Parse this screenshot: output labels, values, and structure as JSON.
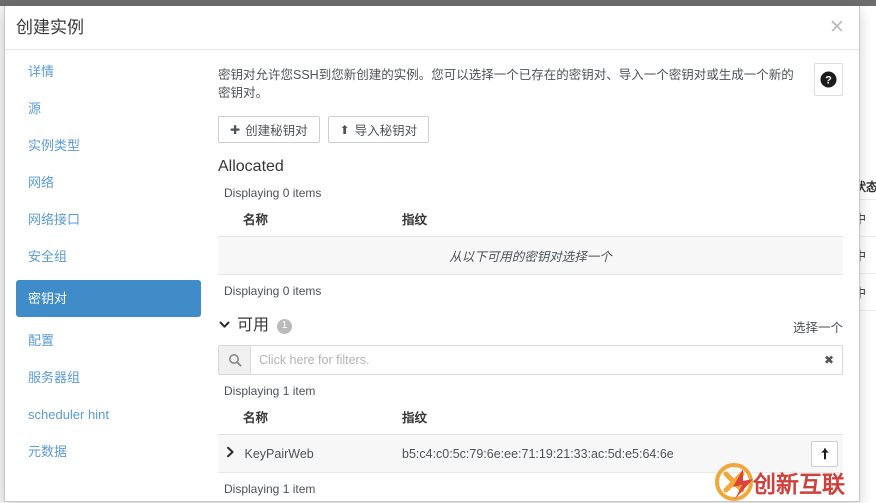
{
  "background": {
    "column_header": "状态",
    "rows": [
      "中",
      "中",
      "中"
    ]
  },
  "modal": {
    "title": "创建实例",
    "close_icon": "close-icon",
    "close_glyph": "✕"
  },
  "sidebar": {
    "items": [
      {
        "label": "详情",
        "active": false
      },
      {
        "label": "源",
        "active": false
      },
      {
        "label": "实例类型",
        "active": false
      },
      {
        "label": "网络",
        "active": false
      },
      {
        "label": "网络接口",
        "active": false
      },
      {
        "label": "安全组",
        "active": false
      },
      {
        "label": "密钥对",
        "active": true
      },
      {
        "label": "配置",
        "active": false
      },
      {
        "label": "服务器组",
        "active": false
      },
      {
        "label": "scheduler hint",
        "active": false
      },
      {
        "label": "元数据",
        "active": false
      }
    ]
  },
  "content": {
    "description": "密钥对允许您SSH到您新创建的实例。您可以选择一个已存在的密钥对、导入一个密钥对或生成一个新的密钥对。",
    "help_icon": "help-circle-icon",
    "buttons": [
      {
        "label": "创建秘钥对",
        "icon": "plus-icon",
        "glyph": "✚"
      },
      {
        "label": "导入秘钥对",
        "icon": "upload-icon",
        "glyph": "⬆"
      }
    ],
    "allocated": {
      "title": "Allocated",
      "count_top": "Displaying 0 items",
      "count_bottom": "Displaying 0 items",
      "columns": {
        "name": "名称",
        "fingerprint": "指纹"
      },
      "empty_message": "从以下可用的密钥对选择一个"
    },
    "available": {
      "caret_icon": "chevron-down-icon",
      "caret_glyph": "❯",
      "title": "可用",
      "badge": "1",
      "hint": "选择一个",
      "filter": {
        "icon": "search-icon",
        "placeholder": "Click here for filters.",
        "value": "",
        "clear_icon": "clear-icon",
        "clear_glyph": "✖"
      },
      "count_top": "Displaying 1 item",
      "count_bottom": "Displaying 1 item",
      "columns": {
        "name": "名称",
        "fingerprint": "指纹"
      },
      "rows": [
        {
          "expand_icon": "chevron-right-icon",
          "expand_glyph": "❯",
          "name": "KeyPairWeb",
          "fingerprint": "b5:c4:c0:5c:79:6e:ee:71:19:21:33:ac:5d:e5:64:6e",
          "action_icon": "arrow-up-icon",
          "action_glyph": "↑"
        }
      ]
    }
  },
  "watermark": {
    "text": "创新互联"
  },
  "colors": {
    "accent": "#3f8cc9",
    "link": "#5a9bd4",
    "text": "#4d5258",
    "heading": "#363636",
    "watermark": "#c9302c"
  }
}
